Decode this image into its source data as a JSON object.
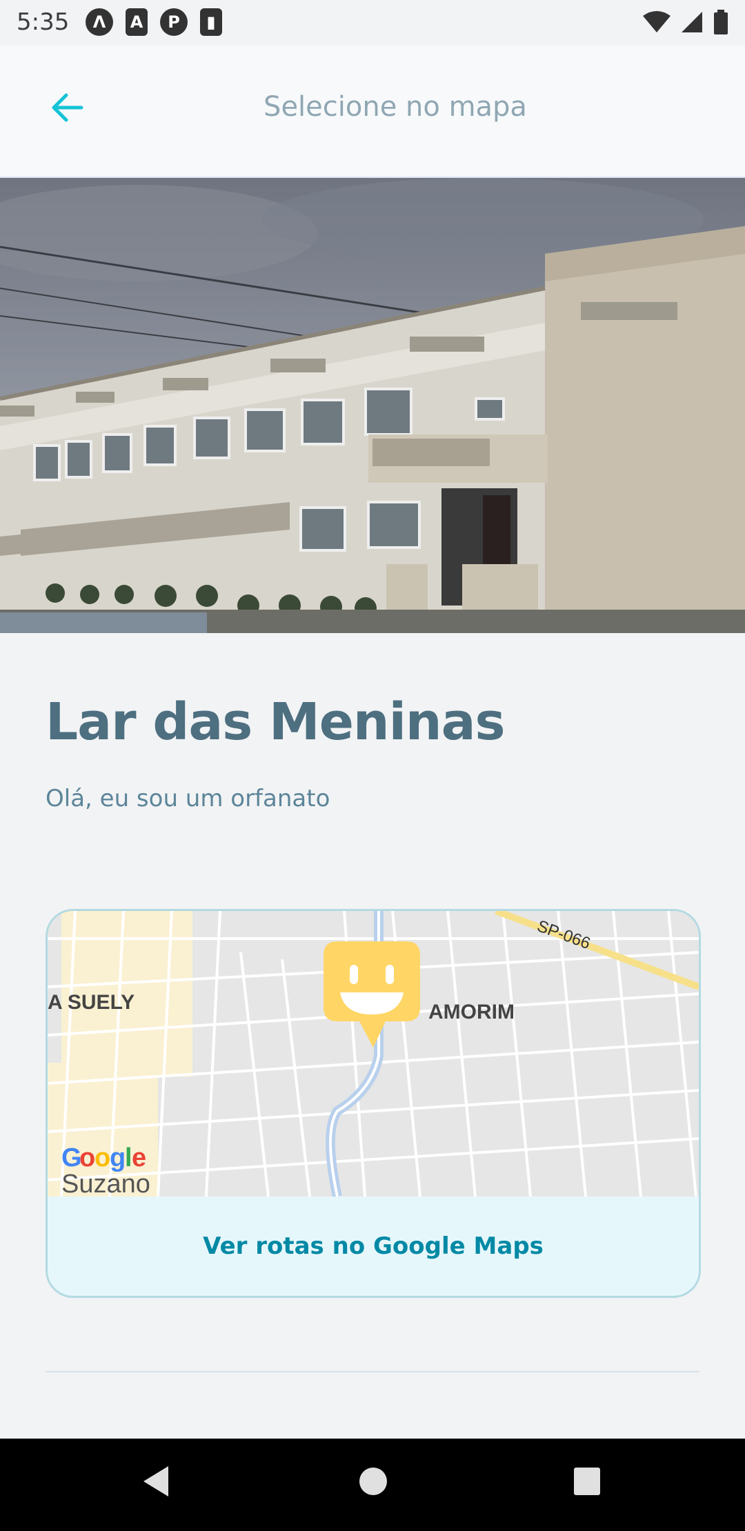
{
  "status_bar": {
    "time": "5:35",
    "left_icons": [
      "a-icon",
      "font-icon",
      "pocket-casts-icon",
      "sd-card-icon"
    ],
    "right_icons": [
      "wifi-icon",
      "signal-icon",
      "battery-icon"
    ]
  },
  "header": {
    "title": "Selecione no mapa",
    "back_icon": "arrow-left-icon",
    "accent": "#15c3d6"
  },
  "place": {
    "name": "Lar das Meninas",
    "description": "Olá, eu sou um orfanato"
  },
  "map": {
    "labels": {
      "neighborhood_left": "A SUELY",
      "neighborhood_right": "AMORIM",
      "road": "SP-066",
      "city": "Suzano",
      "logo": "Google"
    },
    "marker_icon": "smiley-marker-icon",
    "marker_color": "#ffd666",
    "route_link": "Ver rotas no Google Maps"
  },
  "nav": {
    "buttons": [
      "back-triangle-icon",
      "home-circle-icon",
      "recents-square-icon"
    ]
  }
}
